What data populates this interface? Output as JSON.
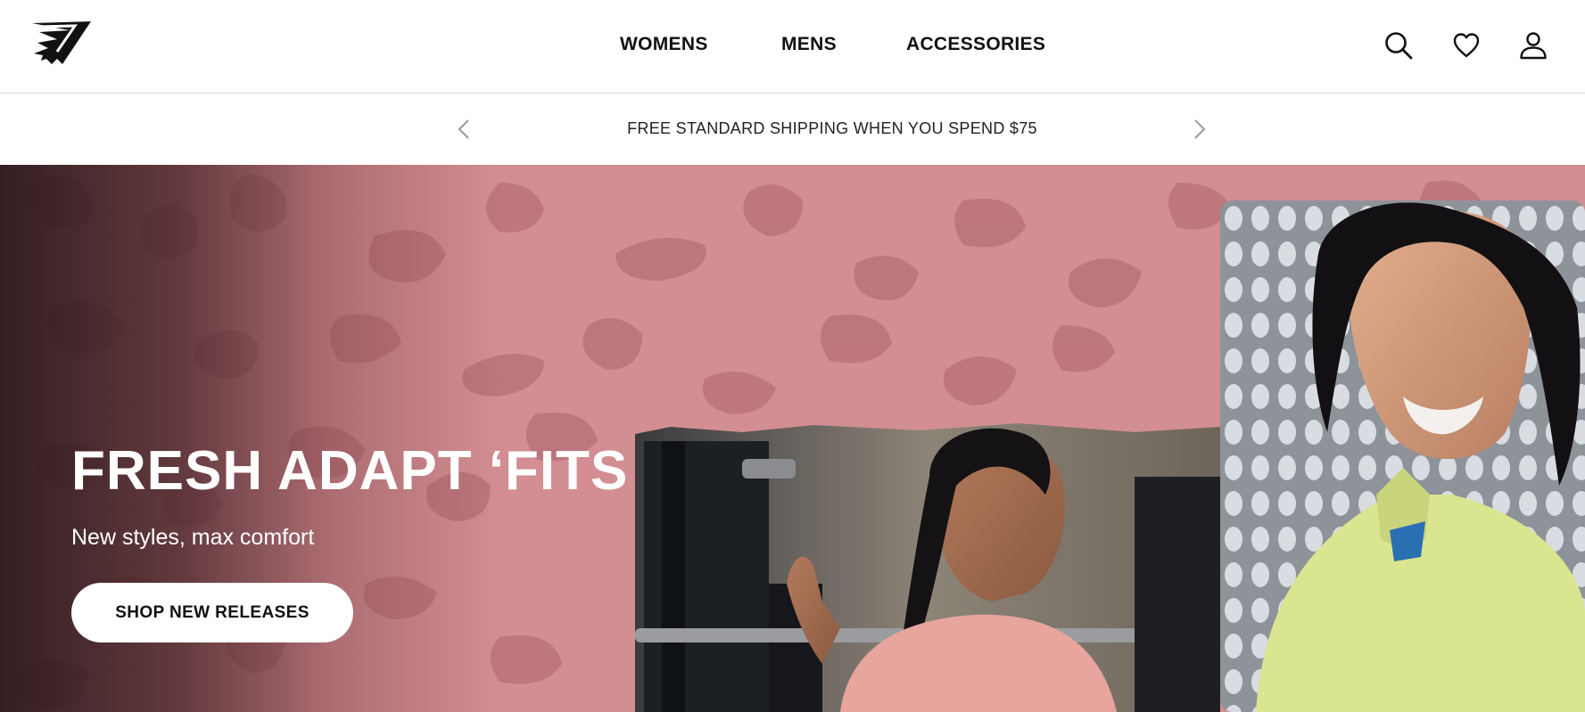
{
  "header": {
    "logo_icon": "gymshark-logo-icon",
    "nav": [
      {
        "label": "WOMENS"
      },
      {
        "label": "MENS"
      },
      {
        "label": "ACCESSORIES"
      }
    ],
    "icons": [
      "search-icon",
      "heart-icon",
      "user-icon"
    ]
  },
  "promo": {
    "text": "FREE STANDARD SHIPPING WHEN YOU SPEND $75",
    "prev_icon": "chevron-left-icon",
    "next_icon": "chevron-right-icon"
  },
  "hero": {
    "title": "FRESH ADAPT ‘FITS",
    "subtitle": "New styles, max comfort",
    "cta_label": "SHOP NEW RELEASES",
    "colors": {
      "background": "#d28e92",
      "pattern": "#b56f76",
      "overlay_dark": "#281618",
      "button_bg": "#ffffff",
      "button_text": "#111111"
    }
  }
}
